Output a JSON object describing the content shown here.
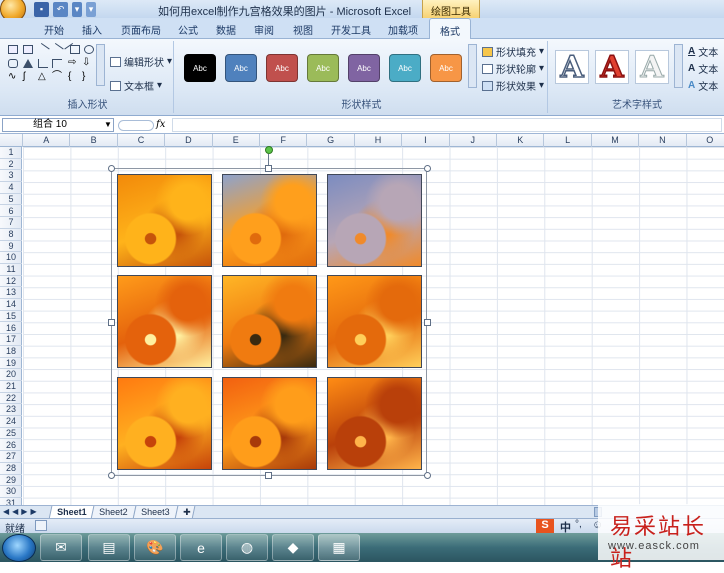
{
  "window": {
    "title": "如何用excel制作九宫格效果的图片 - Microsoft Excel",
    "context_tab": "绘图工具"
  },
  "tabs": [
    "开始",
    "插入",
    "页面布局",
    "公式",
    "数据",
    "审阅",
    "视图",
    "开发工具",
    "加载项",
    "格式"
  ],
  "active_tab": "格式",
  "ribbon": {
    "insert_shapes": {
      "label": "插入形状",
      "edit_shape": "编辑形状",
      "textbox": "文本框"
    },
    "shape_styles": {
      "label": "形状样式",
      "swatches": [
        {
          "text": "Abc",
          "color": "#000000"
        },
        {
          "text": "Abc",
          "color": "#4f81bd"
        },
        {
          "text": "Abc",
          "color": "#c0504d"
        },
        {
          "text": "Abc",
          "color": "#9bbb59"
        },
        {
          "text": "Abc",
          "color": "#8064a2"
        },
        {
          "text": "Abc",
          "color": "#4bacc6"
        },
        {
          "text": "Abc",
          "color": "#f79646"
        }
      ],
      "fill": "形状填充",
      "outline": "形状轮廓",
      "effects": "形状效果"
    },
    "wordart": {
      "label": "艺术字样式",
      "text_item": "文本"
    }
  },
  "formula_bar": {
    "name_box": "组合 10",
    "fx": "fx",
    "value": ""
  },
  "columns": [
    "A",
    "B",
    "C",
    "D",
    "E",
    "F",
    "G",
    "H",
    "I",
    "J",
    "K",
    "L",
    "M",
    "N",
    "O"
  ],
  "rows": [
    "1",
    "2",
    "3",
    "4",
    "5",
    "6",
    "7",
    "8",
    "9",
    "10",
    "11",
    "12",
    "13",
    "14",
    "15",
    "16",
    "17",
    "18",
    "19",
    "20",
    "21",
    "22",
    "23",
    "24",
    "25",
    "26",
    "27",
    "28",
    "29",
    "30",
    "31"
  ],
  "sheets": [
    "Sheet1",
    "Sheet2",
    "Sheet3"
  ],
  "active_sheet": "Sheet1",
  "status": {
    "ready": "就绪"
  },
  "ime": {
    "lang": "中"
  },
  "watermark": {
    "text": "易采站长站",
    "url": "www.easck.com"
  },
  "tiles": [
    {
      "name": "tile-r1c1",
      "palette": [
        "#f28a0a",
        "#ffb31a",
        "#c6540a"
      ]
    },
    {
      "name": "tile-r1c2",
      "palette": [
        "#8ea2cc",
        "#ff9f1c",
        "#e06b0d"
      ]
    },
    {
      "name": "tile-r1c3",
      "palette": [
        "#7c8cc0",
        "#b7a6b6",
        "#f08a2a"
      ]
    },
    {
      "name": "tile-r2c1",
      "palette": [
        "#ff9b1a",
        "#e4620c",
        "#fff0a0"
      ]
    },
    {
      "name": "tile-r2c2",
      "palette": [
        "#ffb626",
        "#f07b10",
        "#3a2a10"
      ]
    },
    {
      "name": "tile-r2c3",
      "palette": [
        "#ff9818",
        "#e46a0c",
        "#ffcf5a"
      ]
    },
    {
      "name": "tile-r3c1",
      "palette": [
        "#ff7a10",
        "#ffb020",
        "#c6430a"
      ]
    },
    {
      "name": "tile-r3c2",
      "palette": [
        "#f26010",
        "#ff9d1a",
        "#a83a0a"
      ]
    },
    {
      "name": "tile-r3c3",
      "palette": [
        "#ff8c14",
        "#b9400a",
        "#ffb44a"
      ]
    }
  ]
}
